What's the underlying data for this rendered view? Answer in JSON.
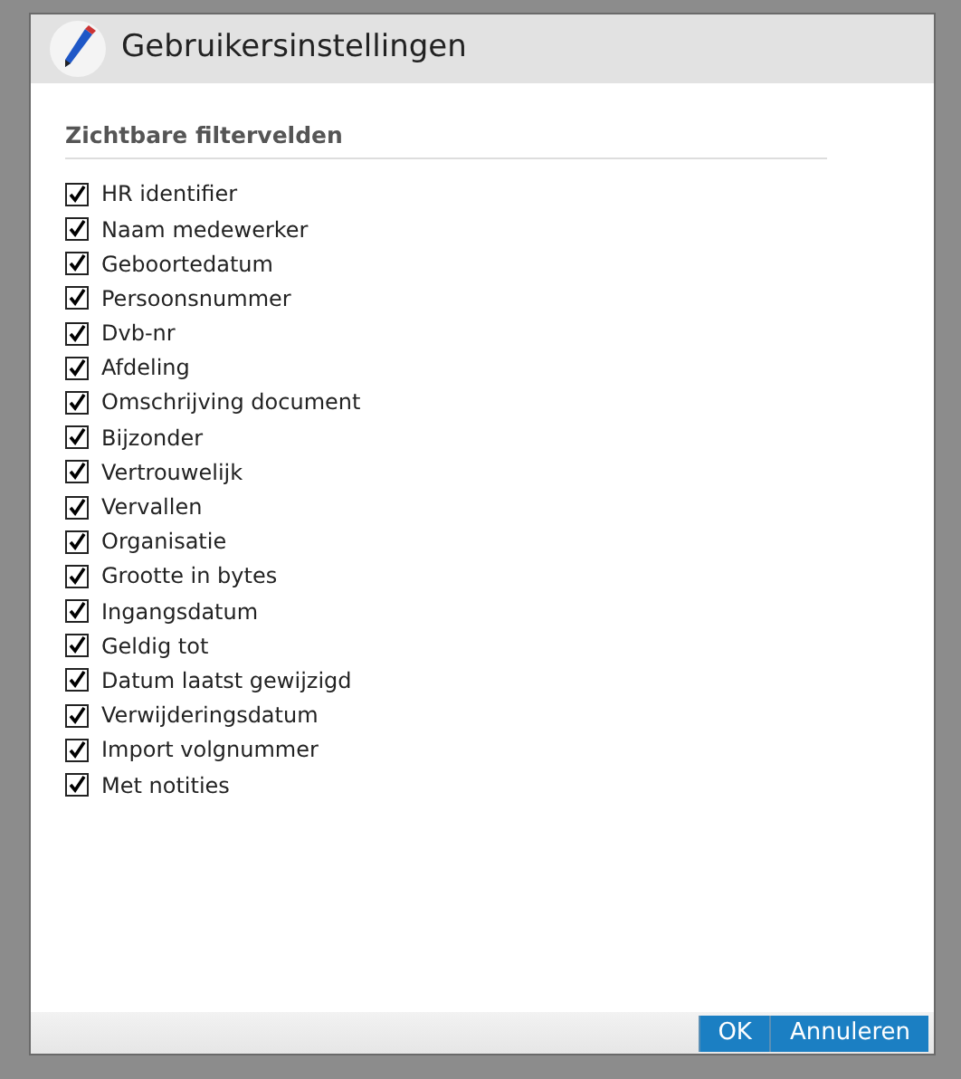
{
  "dialog": {
    "title": "Gebruikersinstellingen"
  },
  "section": {
    "title": "Zichtbare filtervelden"
  },
  "fields": [
    {
      "label": "HR identifier",
      "checked": true
    },
    {
      "label": "Naam medewerker",
      "checked": true
    },
    {
      "label": "Geboortedatum",
      "checked": true
    },
    {
      "label": "Persoonsnummer",
      "checked": true
    },
    {
      "label": "Dvb-nr",
      "checked": true
    },
    {
      "label": "Afdeling",
      "checked": true
    },
    {
      "label": "Omschrijving document",
      "checked": true
    },
    {
      "label": "Bijzonder",
      "checked": true
    },
    {
      "label": "Vertrouwelijk",
      "checked": true
    },
    {
      "label": "Vervallen",
      "checked": true
    },
    {
      "label": "Organisatie",
      "checked": true
    },
    {
      "label": "Grootte in bytes",
      "checked": true
    },
    {
      "label": "Ingangsdatum",
      "checked": true
    },
    {
      "label": "Geldig tot",
      "checked": true
    },
    {
      "label": "Datum laatst gewijzigd",
      "checked": true
    },
    {
      "label": "Verwijderingsdatum",
      "checked": true
    },
    {
      "label": "Import volgnummer",
      "checked": true
    },
    {
      "label": "Met notities",
      "checked": true
    }
  ],
  "buttons": [
    {
      "label": "OK"
    },
    {
      "label": "Annuleren"
    }
  ]
}
